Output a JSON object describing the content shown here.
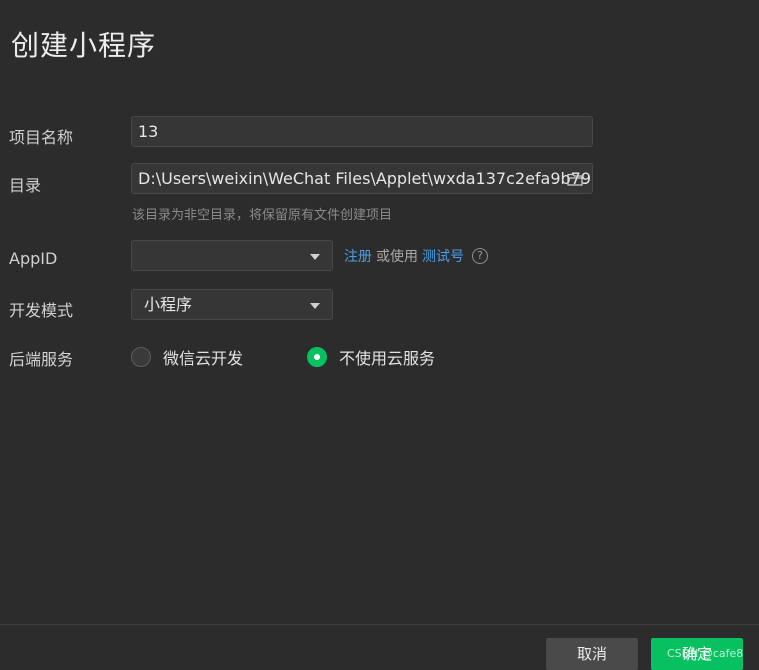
{
  "dialog": {
    "title": "创建小程序"
  },
  "form": {
    "project_name": {
      "label": "项目名称",
      "value": "13"
    },
    "directory": {
      "label": "目录",
      "value": "D:\\Users\\weixin\\WeChat Files\\Applet\\wxda137c2efa9b79",
      "hint": "该目录为非空目录，将保留原有文件创建项目",
      "icon": "folder-icon"
    },
    "appid": {
      "label": "AppID",
      "value": "",
      "register_link": "注册",
      "or_use_text": "或使用",
      "test_account_link": "测试号",
      "help_icon": "?"
    },
    "dev_mode": {
      "label": "开发模式",
      "value": "小程序"
    },
    "backend": {
      "label": "后端服务",
      "options": [
        {
          "label": "微信云开发",
          "checked": false
        },
        {
          "label": "不使用云服务",
          "checked": true
        }
      ]
    }
  },
  "footer": {
    "cancel_label": "取消",
    "ok_label": "确定",
    "watermark": "CSDN @cafe8"
  },
  "colors": {
    "background": "#2c2c2c",
    "accent": "#07c160",
    "link": "#4a9eea"
  }
}
